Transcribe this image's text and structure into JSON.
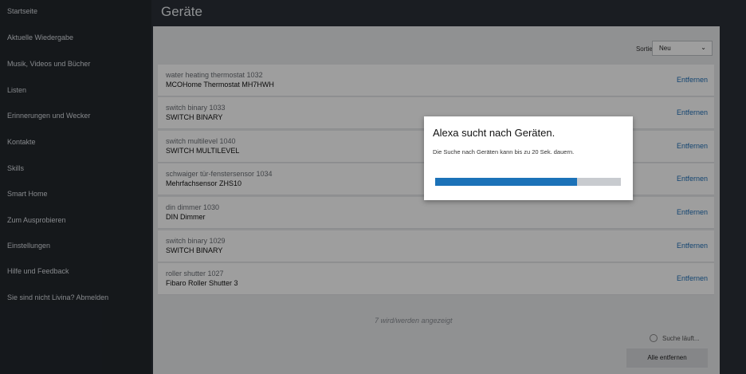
{
  "sidebar": {
    "items": [
      {
        "label": "Startseite"
      },
      {
        "label": "Aktuelle Wiedergabe"
      },
      {
        "label": "Musik, Videos und Bücher"
      },
      {
        "label": "Listen"
      },
      {
        "label": "Erinnerungen und Wecker"
      },
      {
        "label": "Kontakte"
      },
      {
        "label": "Skills"
      },
      {
        "label": "Smart Home"
      },
      {
        "label": "Zum Ausprobieren"
      },
      {
        "label": "Einstellungen"
      },
      {
        "label": "Hilfe und Feedback"
      },
      {
        "label": "Sie sind nicht Livina? Abmelden"
      }
    ]
  },
  "header": {
    "title": "Geräte"
  },
  "sort": {
    "label": "Sortieren nach",
    "value": "Neu"
  },
  "devices": [
    {
      "type": "water heating thermostat 1032",
      "name": "MCOHome Thermostat MH7HWH",
      "action": "Entfernen"
    },
    {
      "type": "switch binary 1033",
      "name": "SWITCH BINARY",
      "action": "Entfernen"
    },
    {
      "type": "switch multilevel 1040",
      "name": "SWITCH MULTILEVEL",
      "action": "Entfernen"
    },
    {
      "type": "schwaiger tür-fenstersensor 1034",
      "name": "Mehrfachsensor ZHS10",
      "action": "Entfernen"
    },
    {
      "type": "din dimmer 1030",
      "name": "DIN Dimmer",
      "action": "Entfernen"
    },
    {
      "type": "switch binary 1029",
      "name": "SWITCH BINARY",
      "action": "Entfernen"
    },
    {
      "type": "roller shutter 1027",
      "name": "Fibaro Roller Shutter 3",
      "action": "Entfernen"
    }
  ],
  "footer": {
    "count_text": "7 wird/werden angezeigt",
    "searching_text": "Suche läuft...",
    "remove_all_label": "Alle entfernen"
  },
  "modal": {
    "title": "Alexa sucht nach Geräten.",
    "subtitle": "Die Suche nach Geräten kann bis zu 20 Sek. dauern.",
    "progress_fraction": 0.765
  },
  "colors": {
    "accent": "#1c72b8",
    "link": "#1f6fb6",
    "sidebar_bg": "#22272d"
  }
}
